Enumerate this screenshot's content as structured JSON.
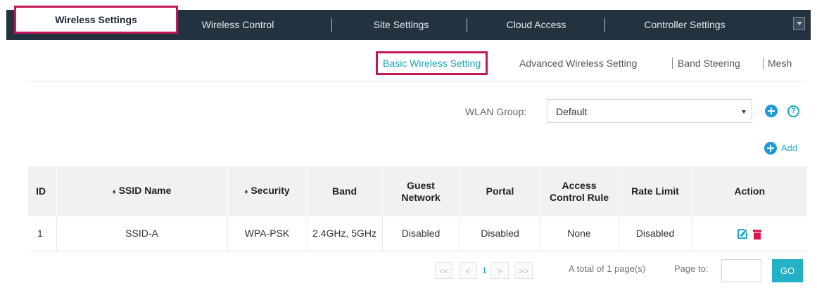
{
  "top_tabs": [
    {
      "label": "Wireless Settings",
      "active": true
    },
    {
      "label": "Wireless Control",
      "active": false
    },
    {
      "label": "Site Settings",
      "active": false
    },
    {
      "label": "Cloud Access",
      "active": false
    },
    {
      "label": "Controller Settings",
      "active": false
    }
  ],
  "sub_tabs": [
    {
      "label": "Basic Wireless Setting",
      "active": true
    },
    {
      "label": "Advanced Wireless Setting",
      "active": false
    },
    {
      "label": "Band Steering",
      "active": false
    },
    {
      "label": "Mesh",
      "active": false
    }
  ],
  "wlan_group": {
    "label": "WLAN Group:",
    "value": "Default"
  },
  "add_label": "Add",
  "help_symbol": "?",
  "table": {
    "headers": {
      "id": "ID",
      "ssid": "SSID Name",
      "security": "Security",
      "band": "Band",
      "guest": "Guest Network",
      "portal": "Portal",
      "acl": "Access Control Rule",
      "rate": "Rate Limit",
      "action": "Action"
    },
    "sort_glyph": "♦",
    "rows": [
      {
        "id": "1",
        "ssid": "SSID-A",
        "security": "WPA-PSK",
        "band": "2.4GHz, 5GHz",
        "guest": "Disabled",
        "portal": "Disabled",
        "acl": "None",
        "rate": "Disabled"
      }
    ]
  },
  "pager": {
    "first": "<<",
    "prev": "<",
    "current": "1",
    "next": ">",
    "last": ">>",
    "total_text": "A total of 1 page(s)",
    "page_to_label": "Page to:",
    "go_label": "GO"
  },
  "colors": {
    "nav_bg": "#23323f",
    "highlight_border": "#c2185b",
    "accent": "#1ea7cf",
    "go_button": "#22b1c6",
    "delete": "#d6184d"
  },
  "icons": {
    "add": "plus-circle-icon",
    "help": "question-circle-icon",
    "edit": "edit-icon",
    "delete": "trash-icon",
    "collapse": "chevron-down-icon"
  }
}
